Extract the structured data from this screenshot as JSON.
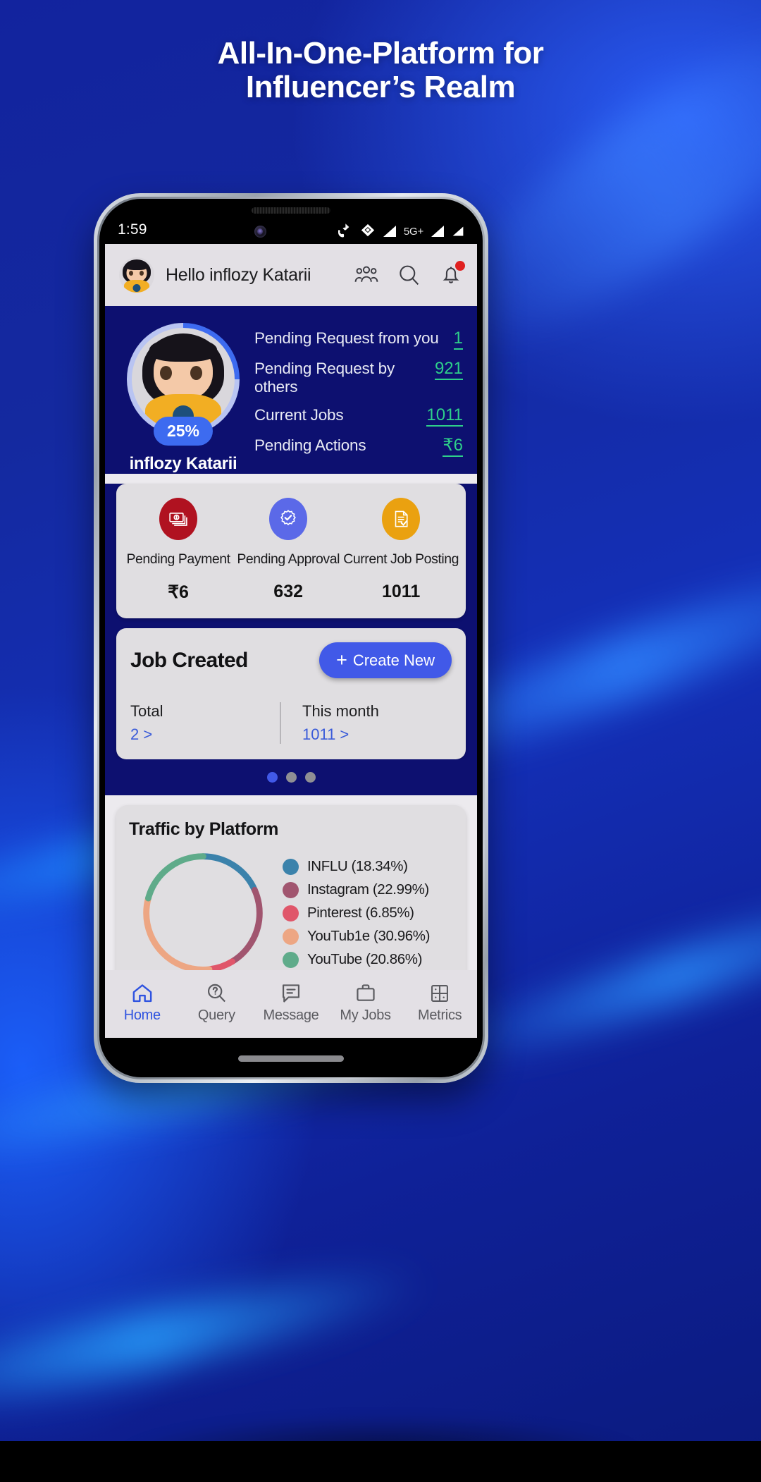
{
  "headline": {
    "line1": "All-In-One-Platform for",
    "line2": "Influencer’s Realm"
  },
  "statusbar": {
    "time": "1:59",
    "network_label": "5G+",
    "icons": [
      "call-wifi-icon",
      "wifi-icon",
      "signal-icon",
      "signal-icon"
    ]
  },
  "header": {
    "greeting": "Hello inflozy Katarii",
    "avatar_name": "avatar",
    "icons": [
      {
        "name": "group-icon"
      },
      {
        "name": "search-icon"
      },
      {
        "name": "bell-icon",
        "badge": true
      }
    ]
  },
  "profile": {
    "name": "inflozy Katarii",
    "completion_percent": "25%",
    "completion_value": 25,
    "ring_color": "#3d6bf0",
    "ring_track_color": "#b9c4f2",
    "stats": [
      {
        "label": "Pending Request from you",
        "value": "1"
      },
      {
        "label": "Pending Request by others",
        "value": "921"
      },
      {
        "label": "Current Jobs",
        "value": "1011"
      },
      {
        "label": "Pending Actions",
        "value": "₹6"
      }
    ],
    "stat_value_color": "#2ecf8a"
  },
  "metrics": [
    {
      "label": "Pending Payment",
      "value": "₹6",
      "icon": "money-icon",
      "color": "#b01220"
    },
    {
      "label": "Pending Approval",
      "value": "632",
      "icon": "verified-icon",
      "color": "#5b69e8"
    },
    {
      "label": "Current Job Posting",
      "value": "1011",
      "icon": "document-check-icon",
      "color": "#eaa110"
    }
  ],
  "job_created": {
    "title": "Job Created",
    "create_button": "Create New",
    "create_button_color": "#4159e8",
    "total_label": "Total",
    "total_value": "2 >",
    "month_label": "This month",
    "month_value": "1011 >"
  },
  "carousel_top": {
    "count": 3,
    "active": 0
  },
  "carousel_bottom": {
    "count": 5,
    "active": 0
  },
  "chart_data": {
    "type": "pie",
    "title": "Traffic by Platform",
    "categories": [
      "INFLU",
      "Instagram",
      "Pinterest",
      "YouTub1e",
      "YouTube"
    ],
    "values": [
      18.34,
      22.99,
      6.85,
      30.96,
      20.86
    ],
    "colors": [
      "#3b82ab",
      "#a1556f",
      "#e0566a",
      "#eda683",
      "#5fab8a"
    ],
    "legend": [
      "INFLU (18.34%)",
      "Instagram (22.99%)",
      "Pinterest (6.85%)",
      "YouTub1e (30.96%)",
      "YouTube (20.86%)"
    ],
    "legend_position": "right",
    "donut": true,
    "grid": false,
    "xlabel": "",
    "ylabel": ""
  },
  "bottom_nav": {
    "items": [
      {
        "label": "Home",
        "icon": "home-icon",
        "active": true
      },
      {
        "label": "Query",
        "icon": "query-icon",
        "active": false
      },
      {
        "label": "Message",
        "icon": "message-icon",
        "active": false
      },
      {
        "label": "My Jobs",
        "icon": "briefcase-icon",
        "active": false
      },
      {
        "label": "Metrics",
        "icon": "grid-icon",
        "active": false
      }
    ],
    "active_color": "#2f53e0"
  }
}
